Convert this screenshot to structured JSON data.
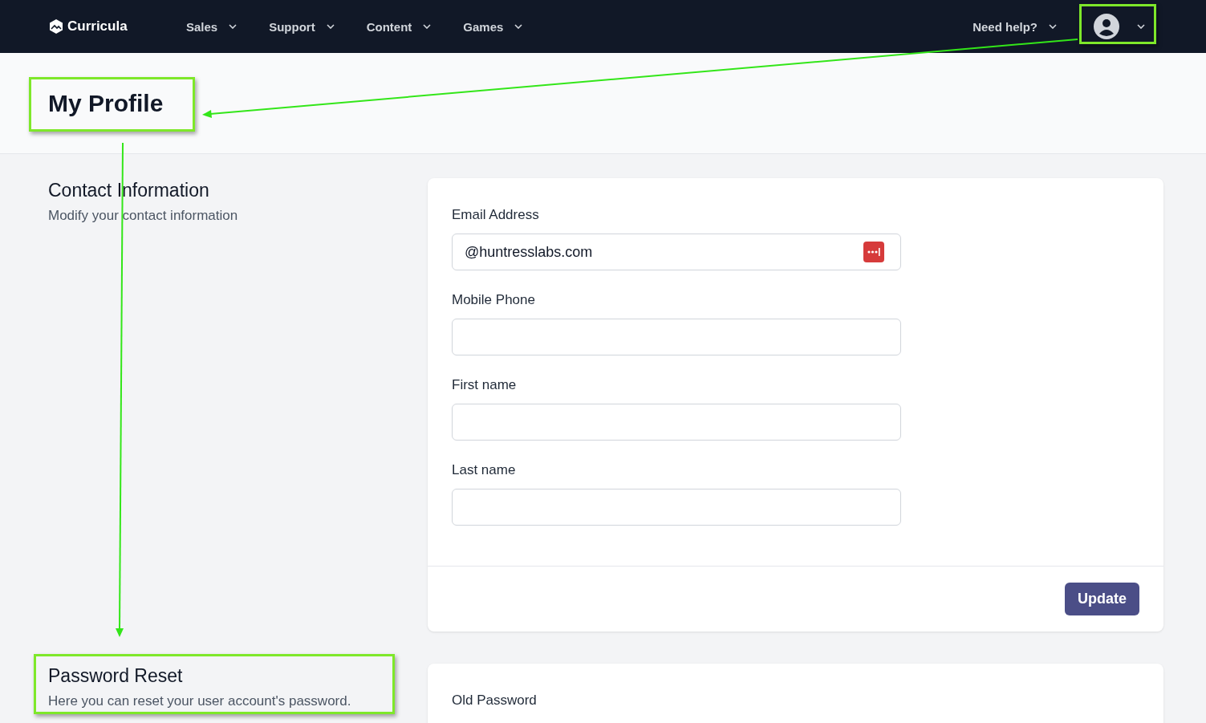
{
  "nav": {
    "brand": "Curricula",
    "menus": [
      {
        "label": "Sales"
      },
      {
        "label": "Support"
      },
      {
        "label": "Content"
      },
      {
        "label": "Games"
      }
    ],
    "help": "Need help?"
  },
  "header": {
    "title": "My Profile"
  },
  "contact": {
    "title": "Contact Information",
    "subtitle": "Modify your contact information",
    "fields": [
      {
        "label": "Email Address",
        "value": "@huntresslabs.com",
        "password_manager": true
      },
      {
        "label": "Mobile Phone",
        "password_manager": false
      },
      {
        "label": "First name",
        "password_manager": false
      },
      {
        "label": "Last name",
        "password_manager": false
      }
    ],
    "button": "Update"
  },
  "password": {
    "title": "Password Reset",
    "subtitle": "Here you can reset your user account's password.",
    "fields": [
      {
        "label": "Old Password"
      }
    ]
  }
}
